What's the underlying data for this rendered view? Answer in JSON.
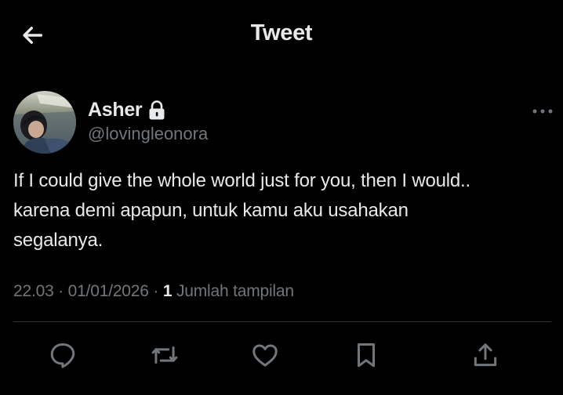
{
  "header": {
    "title": "Tweet",
    "back_icon": "arrow-left-icon"
  },
  "tweet": {
    "author": {
      "name": "Asher",
      "handle": "@lovingleonora",
      "protected_icon": "lock-icon",
      "avatar": "profile-photo"
    },
    "text": "If I could give the whole world just for you, then I would..\nkarena demi apapun, untuk kamu aku usahakan\nsegalanya.",
    "time": "22.03",
    "separator": "·",
    "date": "01/01/2026",
    "views": {
      "count": "1",
      "label": "Jumlah tampilan"
    }
  },
  "actions": [
    {
      "name": "reply",
      "icon": "reply-icon"
    },
    {
      "name": "retweet",
      "icon": "retweet-icon"
    },
    {
      "name": "like",
      "icon": "heart-icon"
    },
    {
      "name": "bookmark",
      "icon": "bookmark-icon"
    },
    {
      "name": "share",
      "icon": "share-icon"
    }
  ],
  "colors": {
    "background": "#000000",
    "text_primary": "#e7e9ea",
    "text_secondary": "#71767b",
    "divider": "#2f3336"
  }
}
